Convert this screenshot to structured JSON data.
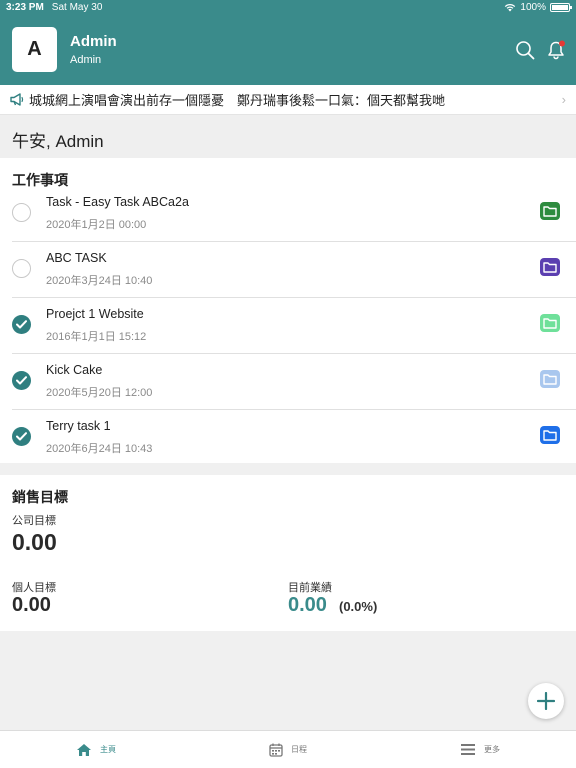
{
  "status": {
    "time": "3:23 PM",
    "date": "Sat May 30",
    "battery": "100%"
  },
  "header": {
    "avatar_letter": "A",
    "user_name": "Admin",
    "user_role": "Admin"
  },
  "announcement": {
    "text": "城城網上演唱會演出前存一個隱憂　鄭丹瑞事後鬆一口氣：個天都幫我哋"
  },
  "greeting": "午安, Admin",
  "tasks": {
    "title": "工作事項",
    "items": [
      {
        "name": "Task - Easy Task ABCa2a",
        "date": "2020年1月2日 00:00",
        "done": false,
        "folder_color": "#2e8b3e"
      },
      {
        "name": "ABC TASK",
        "date": "2020年3月24日 10:40",
        "done": false,
        "folder_color": "#5b3fb0"
      },
      {
        "name": "Proejct 1 Website",
        "date": "2016年1月1日 15:12",
        "done": true,
        "folder_color": "#6fe09a"
      },
      {
        "name": "Kick Cake",
        "date": "2020年5月20日 12:00",
        "done": true,
        "folder_color": "#a9c7ee"
      },
      {
        "name": "Terry task 1",
        "date": "2020年6月24日 10:43",
        "done": true,
        "folder_color": "#1f6fe8"
      }
    ]
  },
  "sales": {
    "title": "銷售目標",
    "company_label": "公司目標",
    "company_value": "0.00",
    "personal_label": "個人目標",
    "personal_value": "0.00",
    "current_label": "目前業績",
    "current_value": "0.00",
    "current_pct": "(0.0%)"
  },
  "tabbar": {
    "home": "主頁",
    "calendar": "日程",
    "more": "更多"
  },
  "colors": {
    "primary": "#3a8b8b",
    "unread_dot": "#e53935"
  }
}
